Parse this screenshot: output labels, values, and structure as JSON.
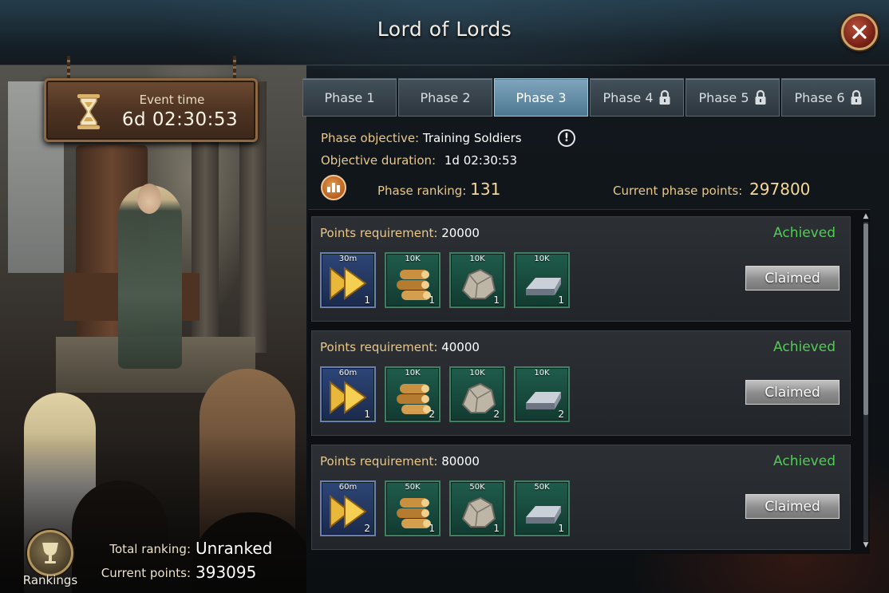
{
  "header": {
    "title": "Lord of Lords"
  },
  "event": {
    "label": "Event time",
    "time": "6d 02:30:53"
  },
  "tabs": [
    {
      "label": "Phase 1",
      "locked": false,
      "active": false
    },
    {
      "label": "Phase 2",
      "locked": false,
      "active": false
    },
    {
      "label": "Phase 3",
      "locked": false,
      "active": true
    },
    {
      "label": "Phase 4",
      "locked": true,
      "active": false
    },
    {
      "label": "Phase 5",
      "locked": true,
      "active": false
    },
    {
      "label": "Phase 6",
      "locked": true,
      "active": false
    }
  ],
  "phase": {
    "objective_label": "Phase objective:",
    "objective_value": "Training Soldiers",
    "duration_label": "Objective duration:",
    "duration_value": "1d 02:30:53",
    "ranking_label": "Phase ranking:",
    "ranking_value": "131",
    "points_label": "Current phase points:",
    "points_value": "297800"
  },
  "rewards": [
    {
      "req_label": "Points requirement:",
      "req_value": "20000",
      "status": "Achieved",
      "button": "Claimed",
      "items": [
        {
          "icon": "speedup-icon",
          "top": "30m",
          "qty": "1"
        },
        {
          "icon": "wood-icon",
          "top": "10K",
          "qty": "1"
        },
        {
          "icon": "stone-icon",
          "top": "10K",
          "qty": "1"
        },
        {
          "icon": "iron-icon",
          "top": "10K",
          "qty": "1"
        }
      ]
    },
    {
      "req_label": "Points requirement:",
      "req_value": "40000",
      "status": "Achieved",
      "button": "Claimed",
      "items": [
        {
          "icon": "speedup-icon",
          "top": "60m",
          "qty": "1"
        },
        {
          "icon": "wood-icon",
          "top": "10K",
          "qty": "2"
        },
        {
          "icon": "stone-icon",
          "top": "10K",
          "qty": "2"
        },
        {
          "icon": "iron-icon",
          "top": "10K",
          "qty": "2"
        }
      ]
    },
    {
      "req_label": "Points requirement:",
      "req_value": "80000",
      "status": "Achieved",
      "button": "Claimed",
      "items": [
        {
          "icon": "speedup-icon",
          "top": "60m",
          "qty": "2"
        },
        {
          "icon": "wood-icon",
          "top": "50K",
          "qty": "1"
        },
        {
          "icon": "stone-icon",
          "top": "50K",
          "qty": "1"
        },
        {
          "icon": "iron-icon",
          "top": "50K",
          "qty": "1"
        }
      ]
    }
  ],
  "footer": {
    "rankings_label": "Rankings",
    "total_ranking_label": "Total ranking:",
    "total_ranking_value": "Unranked",
    "current_points_label": "Current points:",
    "current_points_value": "393095"
  },
  "colors": {
    "accent_gold": "#e9c889",
    "achieved_green": "#55c95a",
    "active_tab": "#6f98b1"
  }
}
